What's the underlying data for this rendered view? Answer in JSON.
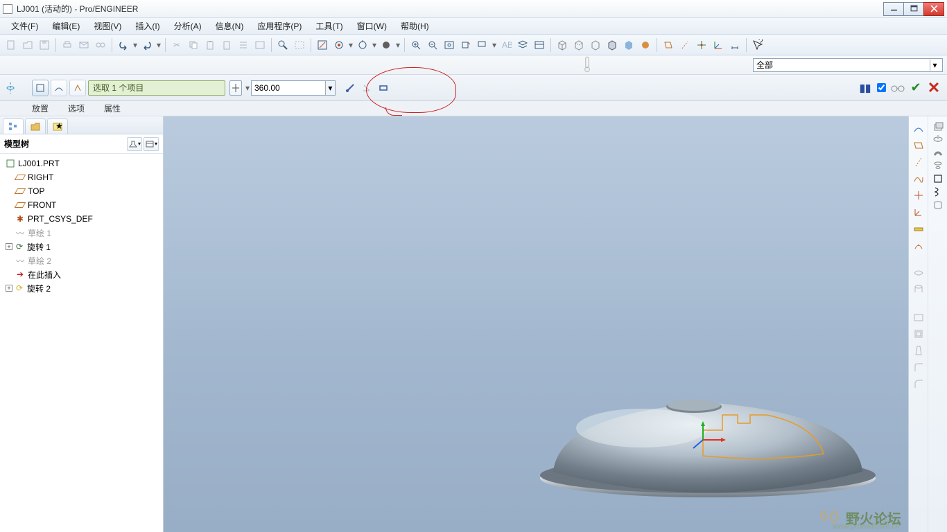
{
  "window": {
    "title": "LJ001 (活动的) - Pro/ENGINEER"
  },
  "menu": {
    "file": "文件(F)",
    "edit": "编辑(E)",
    "view": "视图(V)",
    "insert": "插入(I)",
    "analysis": "分析(A)",
    "info": "信息(N)",
    "app": "应用程序(P)",
    "tools": "工具(T)",
    "window": "窗口(W)",
    "help": "帮助(H)"
  },
  "selector": {
    "all": "全部"
  },
  "dashboard": {
    "pick_text": "选取 1 个项目",
    "angle": "360.00",
    "place": "放置",
    "options": "选项",
    "props": "属性"
  },
  "side": {
    "header": "模型树",
    "root": "LJ001.PRT",
    "right": "RIGHT",
    "top": "TOP",
    "front": "FRONT",
    "csys": "PRT_CSYS_DEF",
    "sketch1": "草绘 1",
    "rev1": "旋转 1",
    "sketch2": "草绘 2",
    "insert_here": "在此插入",
    "rev2": "旋转 2"
  },
  "watermark": {
    "name": "野火论坛",
    "url": "www.proewildfire.cn"
  }
}
